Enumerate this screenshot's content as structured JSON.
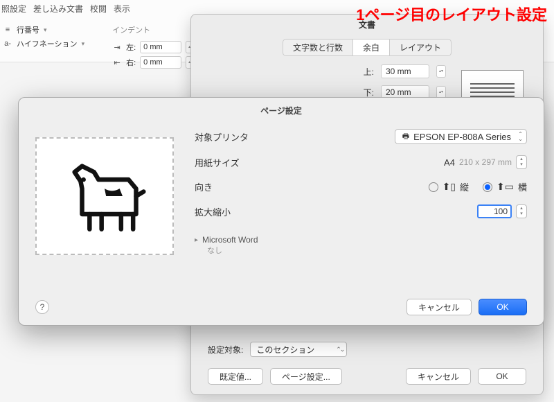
{
  "annotation": "1ページ目のレイアウト設定",
  "ribbon": {
    "tabs": [
      "照設定",
      "差し込み文書",
      "校閲",
      "表示"
    ],
    "lineNumbers": {
      "label": "行番号",
      "icon": "list-icon"
    },
    "hyphenation": {
      "label": "ハイフネーション",
      "icon": "hyphen-icon"
    },
    "indent": {
      "groupLabel": "インデント",
      "left": {
        "label": "左:",
        "value": "0 mm"
      },
      "right": {
        "label": "右:",
        "value": "0 mm"
      }
    }
  },
  "docDialog": {
    "title": "文書",
    "tabs": {
      "chars": "文字数と行数",
      "margins": "余白",
      "layout": "レイアウト"
    },
    "activeTab": "margins",
    "margins": {
      "topLabel": "上:",
      "topValue": "30 mm",
      "bottomLabel": "下:",
      "bottomValue": "20 mm"
    },
    "applyTo": {
      "label": "設定対象:",
      "value": "このセクション"
    },
    "buttons": {
      "defaults": "既定値...",
      "pageSetup": "ページ設定...",
      "cancel": "キャンセル",
      "ok": "OK"
    }
  },
  "pageDialog": {
    "title": "ページ設定",
    "printer": {
      "label": "対象プリンタ",
      "value": "EPSON EP-808A Series"
    },
    "paper": {
      "label": "用紙サイズ",
      "value": "A4",
      "dims": "210 x 297 mm"
    },
    "orientation": {
      "label": "向き",
      "portrait": "縦",
      "landscape": "横",
      "selected": "landscape"
    },
    "scale": {
      "label": "拡大縮小",
      "value": "100"
    },
    "disclosure": {
      "title": "Microsoft Word",
      "sub": "なし"
    },
    "buttons": {
      "help": "?",
      "cancel": "キャンセル",
      "ok": "OK"
    }
  }
}
